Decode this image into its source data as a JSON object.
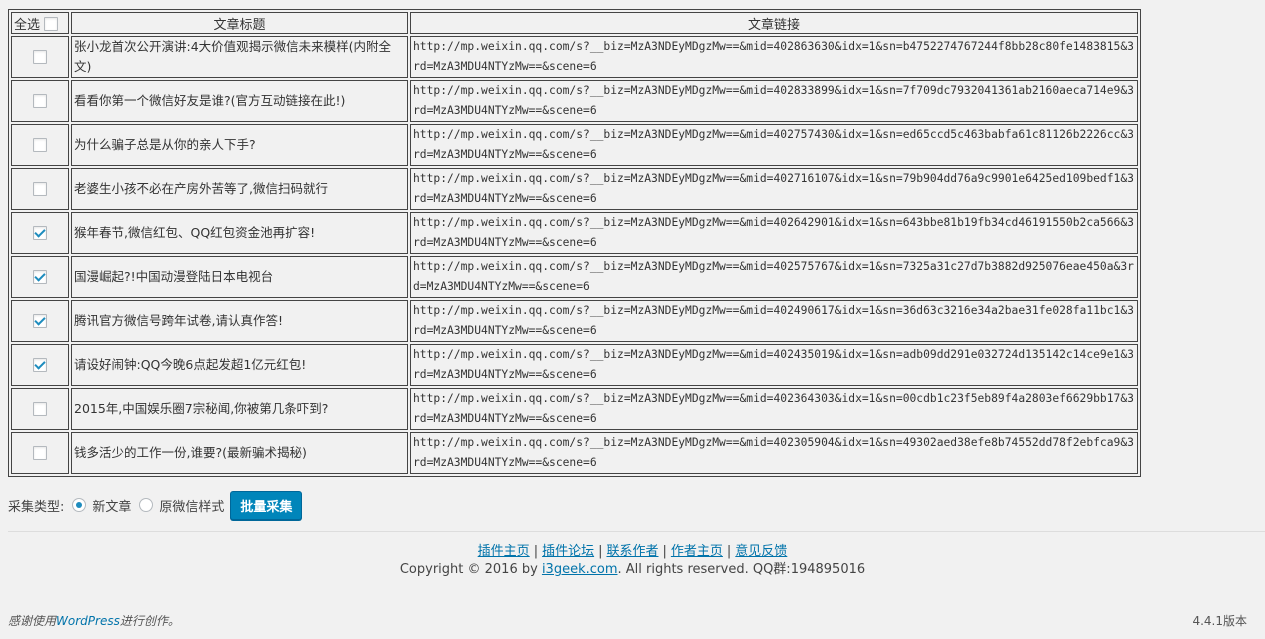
{
  "table": {
    "header": {
      "select_all": "全选",
      "title": "文章标题",
      "link": "文章链接"
    },
    "rows": [
      {
        "checked": false,
        "title": "张小龙首次公开演讲:4大价值观揭示微信未来模样(内附全文)",
        "link": "http://mp.weixin.qq.com/s?__biz=MzA3NDEyMDgzMw==&mid=402863630&idx=1&sn=b4752274767244f8bb28c80fe1483815&3rd=MzA3MDU4NTYzMw==&scene=6"
      },
      {
        "checked": false,
        "title": "看看你第一个微信好友是谁?(官方互动链接在此!)",
        "link": "http://mp.weixin.qq.com/s?__biz=MzA3NDEyMDgzMw==&mid=402833899&idx=1&sn=7f709dc7932041361ab2160aeca714e9&3rd=MzA3MDU4NTYzMw==&scene=6"
      },
      {
        "checked": false,
        "title": "为什么骗子总是从你的亲人下手?",
        "link": "http://mp.weixin.qq.com/s?__biz=MzA3NDEyMDgzMw==&mid=402757430&idx=1&sn=ed65ccd5c463babfa61c81126b2226cc&3rd=MzA3MDU4NTYzMw==&scene=6"
      },
      {
        "checked": false,
        "title": "老婆生小孩不必在产房外苦等了,微信扫码就行",
        "link": "http://mp.weixin.qq.com/s?__biz=MzA3NDEyMDgzMw==&mid=402716107&idx=1&sn=79b904dd76a9c9901e6425ed109bedf1&3rd=MzA3MDU4NTYzMw==&scene=6"
      },
      {
        "checked": true,
        "title": "猴年春节,微信红包、QQ红包资金池再扩容!",
        "link": "http://mp.weixin.qq.com/s?__biz=MzA3NDEyMDgzMw==&mid=402642901&idx=1&sn=643bbe81b19fb34cd46191550b2ca566&3rd=MzA3MDU4NTYzMw==&scene=6"
      },
      {
        "checked": true,
        "title": "国漫崛起?!中国动漫登陆日本电视台",
        "link": "http://mp.weixin.qq.com/s?__biz=MzA3NDEyMDgzMw==&mid=402575767&idx=1&sn=7325a31c27d7b3882d925076eae450a&3rd=MzA3MDU4NTYzMw==&scene=6"
      },
      {
        "checked": true,
        "title": "腾讯官方微信号跨年试卷,请认真作答!",
        "link": "http://mp.weixin.qq.com/s?__biz=MzA3NDEyMDgzMw==&mid=402490617&idx=1&sn=36d63c3216e34a2bae31fe028fa11bc1&3rd=MzA3MDU4NTYzMw==&scene=6"
      },
      {
        "checked": true,
        "title": "请设好闹钟:QQ今晚6点起发超1亿元红包!",
        "link": "http://mp.weixin.qq.com/s?__biz=MzA3NDEyMDgzMw==&mid=402435019&idx=1&sn=adb09dd291e032724d135142c14ce9e1&3rd=MzA3MDU4NTYzMw==&scene=6"
      },
      {
        "checked": false,
        "title": "2015年,中国娱乐圈7宗秘闻,你被第几条吓到?",
        "link": "http://mp.weixin.qq.com/s?__biz=MzA3NDEyMDgzMw==&mid=402364303&idx=1&sn=00cdb1c23f5eb89f4a2803ef6629bb17&3rd=MzA3MDU4NTYzMw==&scene=6"
      },
      {
        "checked": false,
        "title": "钱多活少的工作一份,谁要?(最新骗术揭秘)",
        "link": "http://mp.weixin.qq.com/s?__biz=MzA3NDEyMDgzMw==&mid=402305904&idx=1&sn=49302aed38efe8b74552dd78f2ebfca9&3rd=MzA3MDU4NTYzMw==&scene=6"
      }
    ]
  },
  "collect": {
    "label": "采集类型:",
    "options": [
      {
        "label": "新文章",
        "selected": true
      },
      {
        "label": "原微信样式",
        "selected": false
      }
    ],
    "button": "批量采集"
  },
  "footer": {
    "links": [
      "插件主页",
      "插件论坛",
      "联系作者",
      "作者主页",
      "意见反馈"
    ],
    "separator": "|",
    "copyright_prefix": "Copyright © 2016 by ",
    "copyright_link": "i3geek.com",
    "copyright_suffix": ". All rights reserved. QQ群:194895016"
  },
  "wp": {
    "thanks_prefix": "感谢使用",
    "thanks_link": "WordPress",
    "thanks_suffix": "进行创作。",
    "version": "4.4.1版本"
  },
  "colors": {
    "accent": "#0073aa",
    "button": "#0085ba",
    "check": "#1e8cbe",
    "background": "#f1f1f1"
  }
}
